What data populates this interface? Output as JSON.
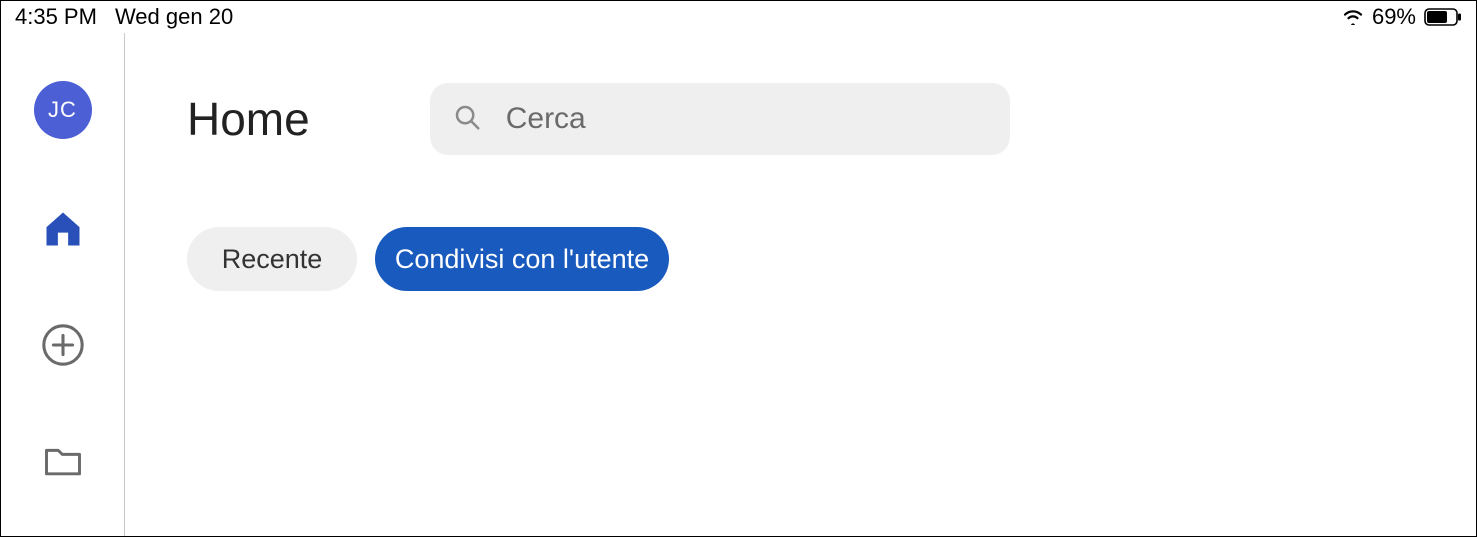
{
  "status_bar": {
    "time": "4:35 PM",
    "date": "Wed gen 20",
    "battery_percent": "69%"
  },
  "sidebar": {
    "avatar_initials": "JC"
  },
  "header": {
    "title": "Home",
    "search_placeholder": "Cerca"
  },
  "tabs": {
    "recent": "Recente",
    "shared": "Condivisi con l'utente"
  },
  "colors": {
    "accent": "#185abd",
    "avatar": "#4c5fd5"
  }
}
